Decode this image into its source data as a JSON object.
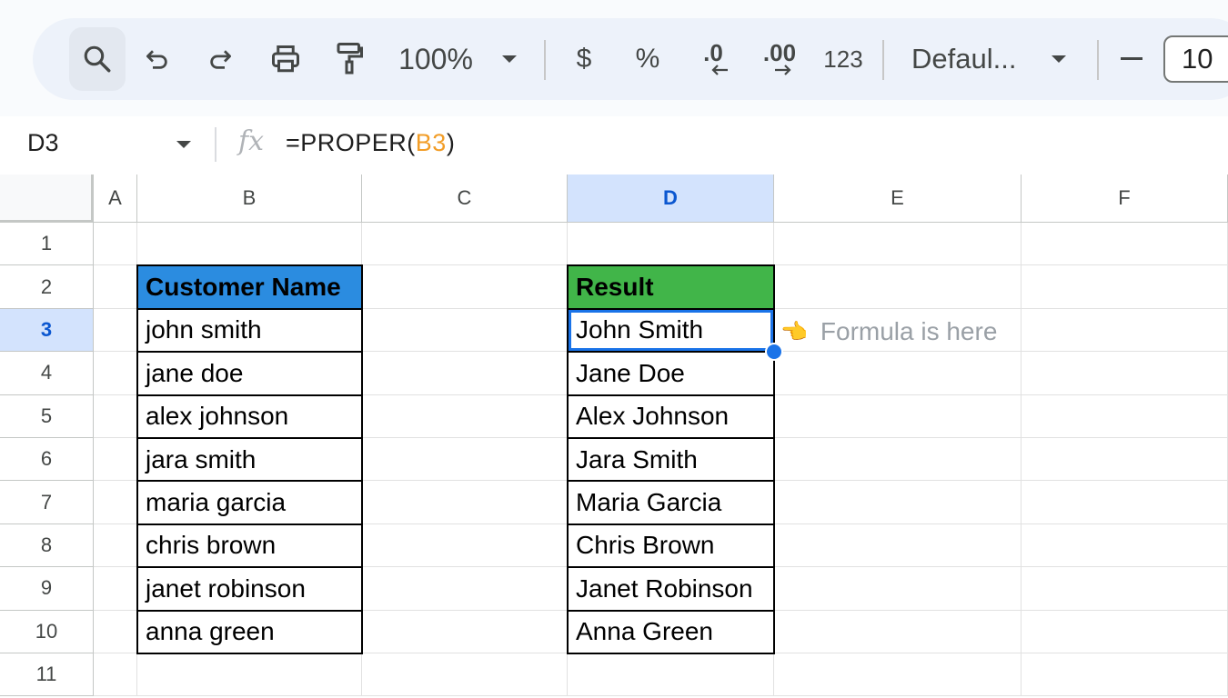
{
  "toolbar": {
    "zoom": "100%",
    "currency_label": "$",
    "percent_label": "%",
    "decrease_decimal_label": ".0",
    "increase_decimal_label": ".00",
    "more_formats_label": "123",
    "font_name": "Defaul...",
    "font_size": "10"
  },
  "formula_bar": {
    "name_box": "D3",
    "formula_prefix": "=PROPER(",
    "formula_ref": "B3",
    "formula_suffix": ")"
  },
  "sheet": {
    "columns": [
      "A",
      "B",
      "C",
      "D",
      "E",
      "F"
    ],
    "rows": [
      "1",
      "2",
      "3",
      "4",
      "5",
      "6",
      "7",
      "8",
      "9",
      "10",
      "11"
    ],
    "selected_column": "D",
    "selected_row": "3",
    "input_header": "Customer Name",
    "result_header": "Result",
    "input_values": [
      "john smith",
      "jane doe",
      "alex johnson",
      "jara smith",
      "maria garcia",
      "chris brown",
      "janet robinson",
      "anna green"
    ],
    "result_values": [
      "John Smith",
      "Jane Doe",
      "Alex Johnson",
      "Jara Smith",
      "Maria Garcia",
      "Chris Brown",
      "Janet Robinson",
      "Anna Green"
    ],
    "note_text": "Formula is here",
    "note_icon": "pointing-hand-icon"
  },
  "colors": {
    "input_header_bg": "#2b8ce0",
    "result_header_bg": "#41b549",
    "selection": "#1a73e8",
    "formula_ref": "#f29d27"
  }
}
